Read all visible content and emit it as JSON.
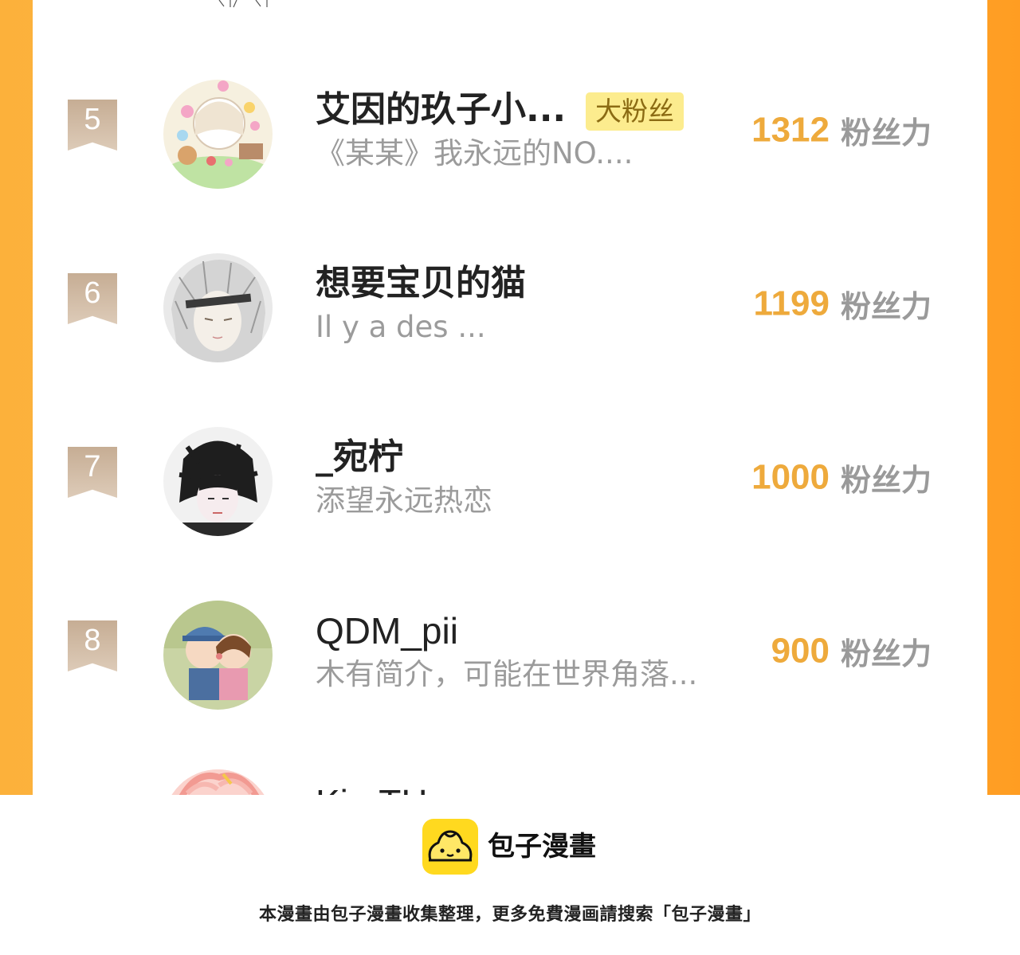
{
  "ranking": {
    "score_unit": "粉丝力",
    "fan_tag": "大粉丝",
    "rows": [
      {
        "rank": "5",
        "name": "艾因的玖子小...",
        "has_tag": true,
        "bio": "《某某》我永远的NO....",
        "score": "1312"
      },
      {
        "rank": "6",
        "name": "想要宝贝的猫",
        "has_tag": false,
        "bio": "Il y a des ...",
        "score": "1199"
      },
      {
        "rank": "7",
        "name": "_宛柠",
        "has_tag": false,
        "bio": "添望永远热恋",
        "score": "1000"
      },
      {
        "rank": "8",
        "name": "QDM_pii",
        "has_tag": false,
        "bio": "木有简介，可能在世界角落...",
        "score": "900"
      }
    ],
    "partial_next": {
      "name": "Ki...TH..."
    }
  },
  "footer": {
    "brand_name": "包子漫畫",
    "note": "本漫畫由包子漫畫收集整理，更多免費漫画請搜索「包子漫畫」"
  },
  "colors": {
    "frame_orange": "#ffb846",
    "score_orange": "#eeaa3c",
    "badge_tan": "#c6ad94",
    "tag_yellow": "#fcec8e",
    "logo_yellow": "#ffd91f"
  }
}
